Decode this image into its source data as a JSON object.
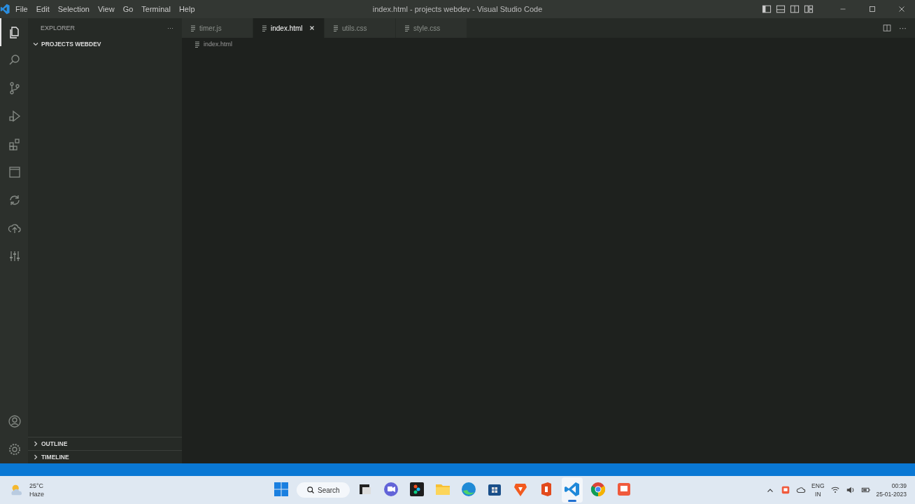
{
  "window": {
    "menu": [
      "File",
      "Edit",
      "Selection",
      "View",
      "Go",
      "Terminal",
      "Help"
    ],
    "title": "index.html - projects webdev - Visual Studio Code"
  },
  "activity_bar": [
    {
      "kind": "files",
      "selected": true
    },
    {
      "kind": "search",
      "selected": false
    },
    {
      "kind": "git",
      "selected": false
    },
    {
      "kind": "run",
      "selected": false
    },
    {
      "kind": "extensions",
      "selected": false
    },
    {
      "kind": "window",
      "selected": false
    },
    {
      "kind": "sync",
      "selected": false
    },
    {
      "kind": "cloud",
      "selected": false
    },
    {
      "kind": "sliders",
      "selected": false
    }
  ],
  "sidebar": {
    "title": "EXPLORER",
    "more": "···",
    "folder": {
      "label": "PROJECTS WEBDEV",
      "expanded": true
    },
    "sections": [
      {
        "label": "OUTLINE",
        "expanded": false
      },
      {
        "label": "TIMELINE",
        "expanded": false
      }
    ]
  },
  "tabs": [
    {
      "label": "timer.js",
      "selected": false
    },
    {
      "label": "index.html",
      "selected": true
    },
    {
      "label": "utils.css",
      "selected": false
    },
    {
      "label": "style.css",
      "selected": false
    }
  ],
  "editor_more": "···",
  "breadcrumb": "index.html",
  "taskbar": {
    "weather": {
      "temp": "25°C",
      "condition": "Haze"
    },
    "search": "Search",
    "apps": [
      {
        "kind": "start",
        "active": false
      },
      {
        "kind": "files",
        "active": false
      },
      {
        "kind": "chat",
        "active": false
      },
      {
        "kind": "figma",
        "active": false
      },
      {
        "kind": "folder",
        "active": false
      },
      {
        "kind": "edge",
        "active": false
      },
      {
        "kind": "store",
        "active": false
      },
      {
        "kind": "brave",
        "active": false
      },
      {
        "kind": "office",
        "active": false
      },
      {
        "kind": "vscode",
        "active": true
      },
      {
        "kind": "chrome",
        "active": false
      },
      {
        "kind": "recorder",
        "active": false
      }
    ],
    "lang": "ENG",
    "region": "IN",
    "time": "00:39",
    "date": "25-01-2023"
  }
}
